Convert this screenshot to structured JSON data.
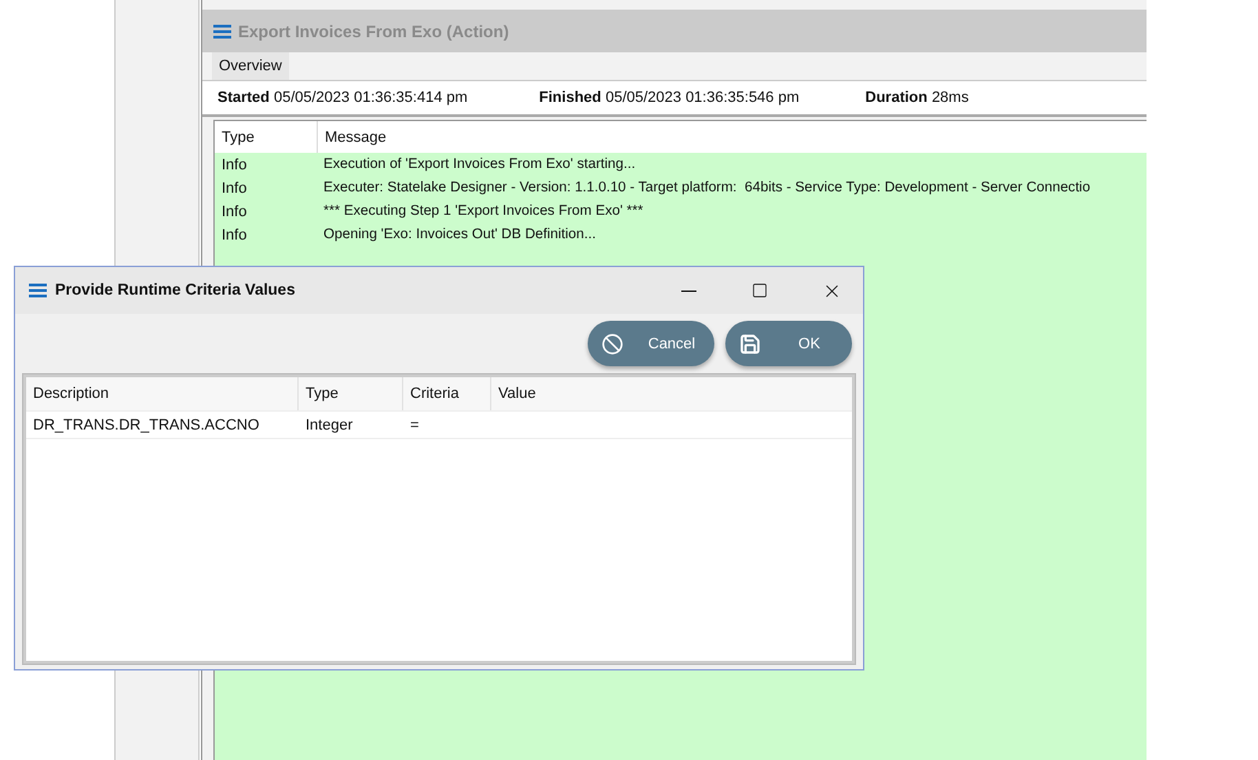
{
  "action_panel": {
    "title": "Export Invoices From Exo (Action)",
    "tabs": [
      {
        "label": "Overview",
        "selected": true
      }
    ],
    "summary": [
      {
        "label": "Started",
        "value": "05/05/2023 01:36:35:414 pm"
      },
      {
        "label": "Finished",
        "value": "05/05/2023 01:36:35:546 pm"
      },
      {
        "label": "Duration",
        "value": "28ms"
      }
    ],
    "log": {
      "columns": [
        "Type",
        "Message"
      ],
      "rows": [
        {
          "type": "Info",
          "message": "Execution of 'Export Invoices From Exo' starting..."
        },
        {
          "type": "Info",
          "message": "Executer: Statelake Designer - Version: 1.1.0.10 - Target platform:  64bits - Service Type: Development - Server Connectio"
        },
        {
          "type": "Info",
          "message": "*** Executing Step 1 'Export Invoices From Exo' ***"
        },
        {
          "type": "Info",
          "message": "Opening 'Exo: Invoices Out' DB Definition..."
        }
      ]
    }
  },
  "dialog": {
    "title": "Provide Runtime Criteria Values",
    "buttons": [
      {
        "kind": "cancel",
        "label": "Cancel"
      },
      {
        "kind": "save",
        "label": "OK"
      }
    ],
    "grid": {
      "columns": [
        "Description",
        "Type",
        "Criteria",
        "Value"
      ],
      "rows": [
        [
          "DR_TRANS.DR_TRANS.ACCNO",
          "Integer",
          "=",
          null
        ]
      ]
    }
  }
}
